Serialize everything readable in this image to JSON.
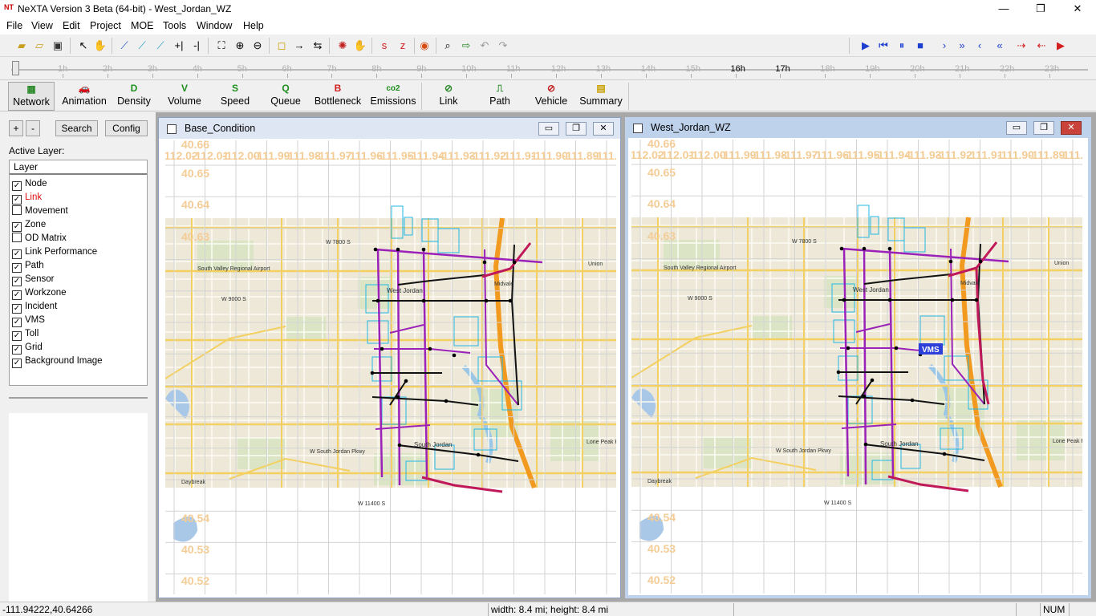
{
  "window": {
    "app_icon": "NT",
    "title": "NeXTA Version 3 Beta (64-bit) - West_Jordan_WZ",
    "controls": [
      "—",
      "❐",
      "✕"
    ]
  },
  "menu": [
    "File",
    "View",
    "Edit",
    "Project",
    "MOE",
    "Tools",
    "Window",
    "Help"
  ],
  "timeline": {
    "hours": [
      "1h",
      "2h",
      "3h",
      "4h",
      "5h",
      "6h",
      "7h",
      "8h",
      "9h",
      "10h",
      "11h",
      "12h",
      "13h",
      "14h",
      "15h",
      "16h",
      "17h",
      "18h",
      "19h",
      "20h",
      "21h",
      "22h",
      "23h"
    ],
    "highlighted_hours": [
      "16h",
      "17h"
    ],
    "slider_hour": 0
  },
  "modes": [
    {
      "label": "Network",
      "icon": "network-grid-icon",
      "glyph": "▦",
      "color": "#2a8a2a"
    },
    {
      "label": "Animation",
      "icon": "car-icon",
      "glyph": "🚗",
      "color": "#2a8a2a"
    },
    {
      "label": "Density",
      "icon": "density-d-icon",
      "glyph": "D",
      "color": "#1e8f1e"
    },
    {
      "label": "Volume",
      "icon": "volume-v-icon",
      "glyph": "V",
      "color": "#1e8f1e"
    },
    {
      "label": "Speed",
      "icon": "speed-s-icon",
      "glyph": "S",
      "color": "#1e8f1e"
    },
    {
      "label": "Queue",
      "icon": "queue-q-icon",
      "glyph": "Q",
      "color": "#1e8f1e"
    },
    {
      "label": "Bottleneck",
      "icon": "bottleneck-b-icon",
      "glyph": "B",
      "color": "#d21e1e"
    },
    {
      "label": "Emissions",
      "icon": "co2-icon",
      "glyph": "co2",
      "color": "#1e8f1e"
    },
    {
      "label": "Link",
      "icon": "link-icon",
      "glyph": "⊘",
      "color": "#2a8a2a"
    },
    {
      "label": "Path",
      "icon": "path-icon",
      "glyph": "⎍",
      "color": "#2a8a2a"
    },
    {
      "label": "Vehicle",
      "icon": "vehicle-icon",
      "glyph": "⊘",
      "color": "#c02020"
    },
    {
      "label": "Summary",
      "icon": "summary-icon",
      "glyph": "▤",
      "color": "#c8a000"
    }
  ],
  "left_panel": {
    "plus": "+",
    "minus": "-",
    "search": "Search",
    "config": "Config",
    "active_layer_label": "Active Layer:",
    "layer_header": "Layer",
    "layers": [
      {
        "name": "Node",
        "checked": true,
        "active": false
      },
      {
        "name": "Link",
        "checked": true,
        "active": true
      },
      {
        "name": "Movement",
        "checked": false,
        "active": false
      },
      {
        "name": "Zone",
        "checked": true,
        "active": false
      },
      {
        "name": "OD Matrix",
        "checked": false,
        "active": false
      },
      {
        "name": "Link Performance",
        "checked": true,
        "active": false
      },
      {
        "name": "Path",
        "checked": true,
        "active": false
      },
      {
        "name": "Sensor",
        "checked": true,
        "active": false
      },
      {
        "name": "Workzone",
        "checked": true,
        "active": false
      },
      {
        "name": "Incident",
        "checked": true,
        "active": false
      },
      {
        "name": "VMS",
        "checked": true,
        "active": false
      },
      {
        "name": "Toll",
        "checked": true,
        "active": false
      },
      {
        "name": "Grid",
        "checked": true,
        "active": false
      },
      {
        "name": "Background Image",
        "checked": true,
        "active": false
      }
    ]
  },
  "views": [
    {
      "title": "Base_Condition",
      "active": false,
      "grid_x_labels": [
        "-112.02",
        "-112.01",
        "-112.00",
        "-111.99",
        "-111.98",
        "-111.97",
        "-111.96",
        "-111.95",
        "-111.94",
        "-111.93",
        "-111.92",
        "-111.91",
        "-111.90",
        "-111.89",
        "-111.88"
      ],
      "grid_y_labels": [
        "40.66",
        "40.65",
        "40.64",
        "40.63",
        "40.54",
        "40.53",
        "40.52"
      ],
      "vms_label": ""
    },
    {
      "title": "West_Jordan_WZ",
      "active": true,
      "grid_x_labels": [
        "-112.02",
        "-112.01",
        "-112.00",
        "-111.99",
        "-111.98",
        "-111.97",
        "-111.96",
        "-111.95",
        "-111.94",
        "-111.93",
        "-111.92",
        "-111.91",
        "-111.90",
        "-111.89",
        "-111.88"
      ],
      "grid_y_labels": [
        "40.66",
        "40.65",
        "40.64",
        "40.63",
        "40.54",
        "40.53",
        "40.52"
      ],
      "vms_label": "VMS"
    }
  ],
  "map_labels": {
    "airport": "South Valley Regional Airport",
    "city1": "West Jordan",
    "city2": "South Jordan",
    "city3": "Midvale",
    "city4": "Union",
    "park": "Lone Peak Park",
    "daybreak": "Daybreak",
    "road1": "W 7800 S",
    "road2": "W 9000 S",
    "road3": "W South Jordan Pkwy",
    "road4": "W 11400 S"
  },
  "status": {
    "coords": "-111.94222,40.64266",
    "size": "width: 8.4 mi; height: 8.4 mi",
    "num": "NUM"
  }
}
